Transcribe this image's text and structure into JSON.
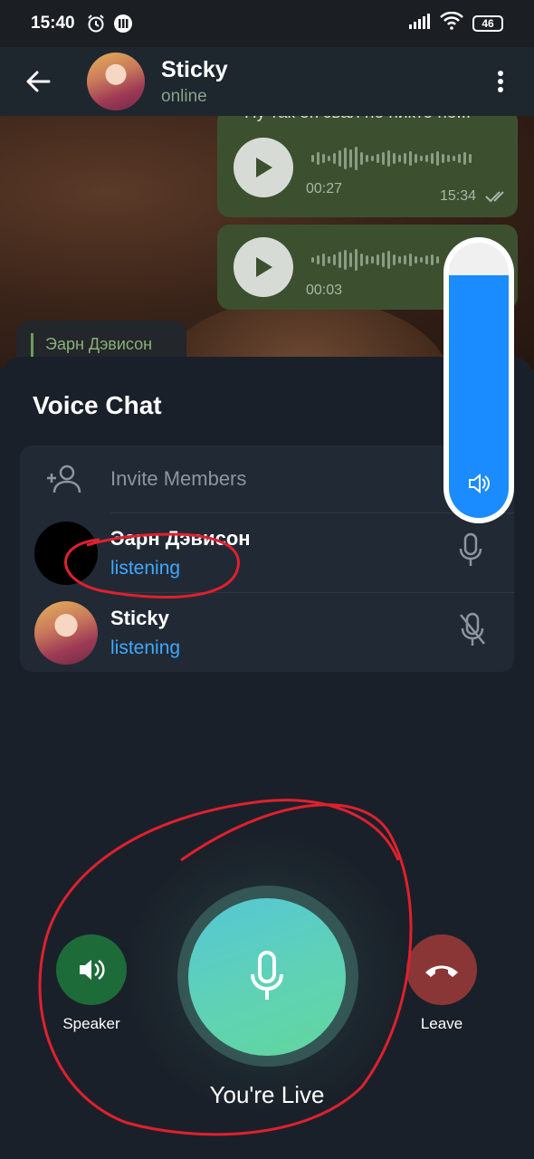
{
  "status_bar": {
    "time": "15:40",
    "battery": "46"
  },
  "header": {
    "name": "Sticky",
    "status": "online"
  },
  "chat": {
    "messages": [
      {
        "text": "Ну так он звал но никто не...",
        "duration": "00:27",
        "time": "15:34"
      },
      {
        "duration": "00:03"
      }
    ],
    "sender_preview": "Эарн Дэвисон"
  },
  "voice_chat": {
    "title": "Voice Chat",
    "invite_label": "Invite Members",
    "participants": [
      {
        "name": "Эарн Дэвисон",
        "state": "listening",
        "mic": "mic-icon"
      },
      {
        "name": "Sticky",
        "state": "listening",
        "mic": "mic-muted-icon"
      }
    ],
    "volume_level": 0.88,
    "controls": {
      "speaker": "Speaker",
      "leave": "Leave",
      "live": "You're Live"
    }
  },
  "colors": {
    "accent": "#3fa8ff",
    "volume_fill": "#1a8cff",
    "speaker_button": "#1e6b3a",
    "leave_button": "#8b3636",
    "mic_button": "#5fd2b5",
    "annotation": "#e0202e"
  }
}
